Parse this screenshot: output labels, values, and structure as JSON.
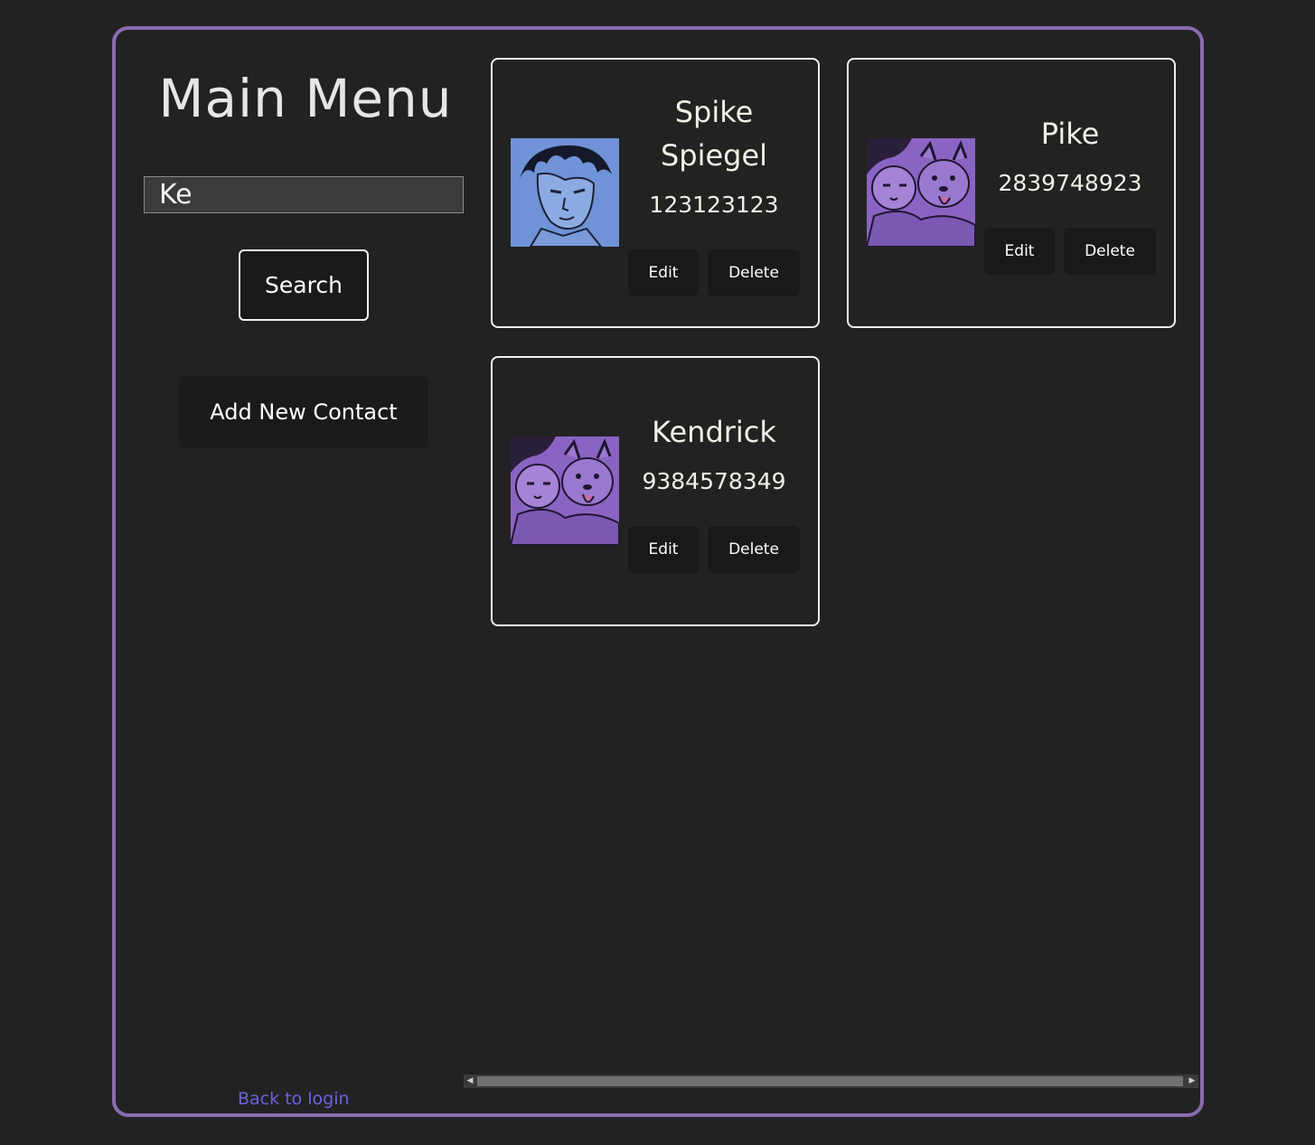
{
  "page": {
    "title": "Main Menu",
    "accent_color": "#8a6bb0",
    "link_color": "#6b63e0"
  },
  "search": {
    "value": "Ke",
    "button_label": "Search"
  },
  "add_contact_label": "Add New Contact",
  "back_link_label": "Back to login",
  "contacts": [
    {
      "name_line1": "Spike",
      "name_line2": "Spiegel",
      "phone": "123123123",
      "edit_label": "Edit",
      "delete_label": "Delete",
      "avatar_icon": "spike-portrait-icon"
    },
    {
      "name_line1": "Pike",
      "phone": "2839748923",
      "edit_label": "Edit",
      "delete_label": "Delete",
      "avatar_icon": "girl-with-dog-icon"
    },
    {
      "name_line1": "Kendrick",
      "phone": "9384578349",
      "edit_label": "Edit",
      "delete_label": "Delete",
      "avatar_icon": "girl-with-dog-icon"
    }
  ]
}
